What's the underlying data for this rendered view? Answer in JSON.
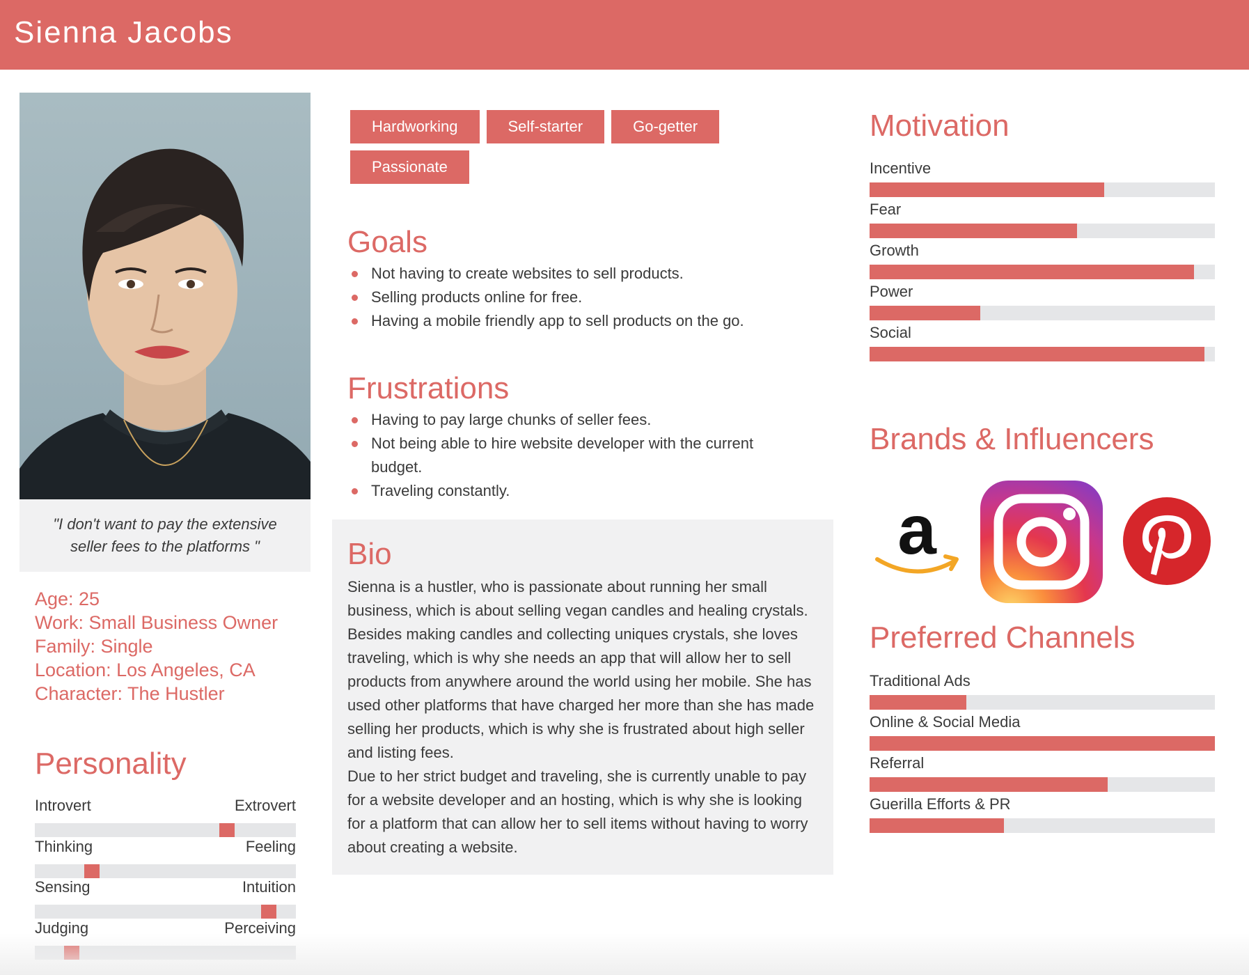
{
  "header": {
    "name": "Sienna Jacobs"
  },
  "profile": {
    "quote": "\"I don't want to pay the extensive seller fees to the platforms \"",
    "info": [
      "Age: 25",
      "Work: Small Business Owner",
      "Family: Single",
      "Location: Los Angeles, CA",
      "Character: The Hustler"
    ]
  },
  "personality": {
    "title": "Personality",
    "pairs": [
      {
        "left": "Introvert",
        "right": "Extrovert",
        "value": 0.75
      },
      {
        "left": "Thinking",
        "right": "Feeling",
        "value": 0.2
      },
      {
        "left": "Sensing",
        "right": "Intuition",
        "value": 0.92
      },
      {
        "left": "Judging",
        "right": "Perceiving",
        "value": 0.12
      }
    ]
  },
  "tags": [
    "Hardworking",
    "Self-starter",
    "Go-getter",
    "Passionate"
  ],
  "goals": {
    "title": "Goals",
    "items": [
      "Not having to create websites to sell products.",
      "Selling products online for free.",
      "Having a mobile friendly app to sell products on the go."
    ]
  },
  "frustrations": {
    "title": "Frustrations",
    "items": [
      "Having to pay large chunks of seller fees.",
      "Not being able to hire website developer with the current budget.",
      "Traveling constantly."
    ]
  },
  "bio": {
    "title": "Bio",
    "paragraphs": [
      "Sienna is a hustler, who is passionate about running her small business, which is about selling vegan candles and healing crystals. Besides making candles and collecting uniques crystals, she loves traveling, which is why she needs an app that will allow her to sell products from anywhere around the world using her mobile. She has used other platforms that have charged her more than she has made selling her products, which is why she is frustrated about high seller and listing fees.",
      "Due to her strict budget and traveling, she is currently unable to pay for a website developer and an hosting, which is why she is looking for a platform that can allow her to sell items without having to worry about creating a website."
    ]
  },
  "motivation": {
    "title": "Motivation",
    "items": [
      {
        "label": "Incentive",
        "value": 0.68
      },
      {
        "label": "Fear",
        "value": 0.6
      },
      {
        "label": "Growth",
        "value": 0.94
      },
      {
        "label": "Power",
        "value": 0.32
      },
      {
        "label": "Social",
        "value": 0.97
      }
    ]
  },
  "brands": {
    "title": "Brands & Influencers",
    "logos": [
      "amazon-logo",
      "instagram-logo",
      "pinterest-logo"
    ]
  },
  "channels": {
    "title": "Preferred Channels",
    "items": [
      {
        "label": "Traditional Ads",
        "value": 0.28
      },
      {
        "label": "Online & Social Media",
        "value": 1.0
      },
      {
        "label": "Referral",
        "value": 0.69
      },
      {
        "label": "Guerilla Efforts & PR",
        "value": 0.39
      }
    ]
  },
  "colors": {
    "accent": "#dc6965",
    "track": "#e5e6e8",
    "panel": "#f1f1f2",
    "text": "#3a3a3a"
  }
}
